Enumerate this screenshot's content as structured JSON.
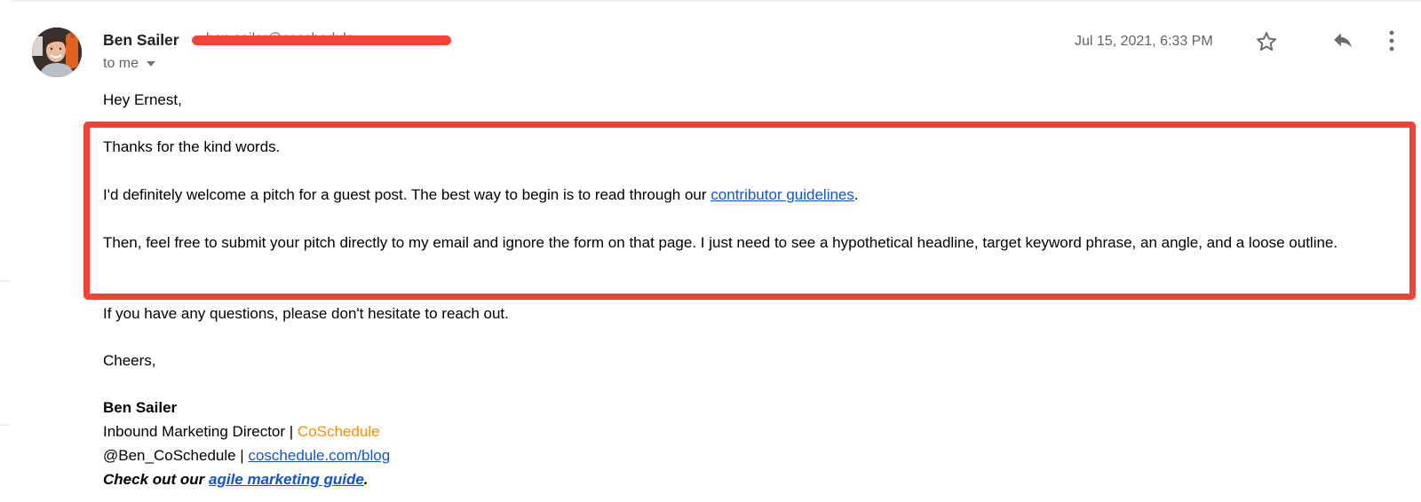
{
  "email": {
    "sender": {
      "name": "Ben Sailer",
      "email_redacted": true,
      "email_ghost_text": "ben.sailer@coschedule"
    },
    "recipient_label": "to me",
    "timestamp": "Jul 15, 2021, 6:33 PM",
    "actions": {
      "star": "star-icon",
      "reply": "reply-icon",
      "more": "more-vert-icon"
    },
    "body": {
      "greeting": "Hey Ernest,",
      "p1": "Thanks for the kind words.",
      "p2_before": "I'd definitely welcome a pitch for a guest post. The best way to begin is to read through our ",
      "p2_link": "contributor guidelines",
      "p2_after": ".",
      "p3": "Then, feel free to submit your pitch directly to my email and ignore the form on that page. I just need to see a hypothetical headline, target keyword phrase, an angle, and a loose outline.",
      "p4": "If you have any questions, please don't hesitate to reach out.",
      "closing": "Cheers,"
    },
    "signature": {
      "name": "Ben Sailer",
      "title": "Inbound Marketing Director | ",
      "company": "CoSchedule",
      "handle": "@Ben_CoSchedule | ",
      "blog_link": "coschedule.com/blog",
      "cta_before": "Check out our ",
      "cta_link": "agile marketing guide",
      "cta_after": "."
    }
  },
  "colors": {
    "highlight": "#f44336",
    "link": "#1155cc",
    "brand": "#f39200",
    "meta_text": "#5f6368"
  }
}
